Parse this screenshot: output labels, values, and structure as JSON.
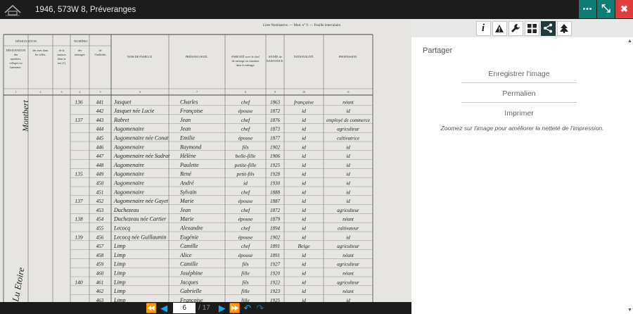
{
  "window": {
    "title": "1946, 573W 8, Préveranges"
  },
  "toolbar": {
    "more_label": "•••",
    "expand_label": "⤡",
    "close_label": "✖"
  },
  "panel": {
    "tools": [
      {
        "name": "info-icon",
        "glyph": "i"
      },
      {
        "name": "warning-icon",
        "glyph": "▲"
      },
      {
        "name": "wrench-icon",
        "glyph": "🔧"
      },
      {
        "name": "grid-icon",
        "glyph": "▦"
      },
      {
        "name": "share-icon",
        "glyph": "⋖"
      },
      {
        "name": "tree-icon",
        "glyph": "♣"
      }
    ],
    "title": "Partager",
    "items": [
      {
        "label": "Enregistrer l'image"
      },
      {
        "label": "Permalien"
      },
      {
        "label": "Imprimer"
      }
    ],
    "hint": "Zoomez sur l'image pour améliorer la netteté de l'impression."
  },
  "document": {
    "header_right": "Liste Nominative. — Mod. n° 9. — Feuille intercalaire.",
    "columns": [
      "DÉSIGNATION des quartiers, villages ou hameaux.",
      "des rues dans les villes.",
      "de la maison dans la rue (1)",
      "des ménages",
      "de l'individu",
      "NOM DE FAMILLE.",
      "PRÉNOM USUEL.",
      "PARENTÉ avec le chef de ménage ou situation dans le ménage.",
      "ANNÉE de NAISSANCE.",
      "NATIONALITÉ.",
      "PROFESSION."
    ],
    "group_designation": "DÉSIGNATION",
    "group_numero": "NUMÉRO",
    "col_numbers": [
      "1",
      "2",
      "3",
      "4",
      "5",
      "6",
      "7",
      "8",
      "9",
      "10",
      "11"
    ],
    "village_left": "Montbert",
    "village_left2": "Lu Etoire",
    "rows": [
      {
        "house": "136",
        "ind": "441",
        "nom": "Jasquet",
        "prenom": "Charles",
        "parente": "chef",
        "annee": "1863",
        "nat": "française",
        "prof": "néant"
      },
      {
        "house": "",
        "ind": "442",
        "nom": "Jasquet née Lucie",
        "prenom": "Françoise",
        "parente": "épouse",
        "annee": "1872",
        "nat": "id",
        "prof": "id"
      },
      {
        "house": "137",
        "ind": "443",
        "nom": "Rabret",
        "prenom": "Jean",
        "parente": "chef",
        "annee": "1876",
        "nat": "id",
        "prof": "employé de commerce"
      },
      {
        "house": "",
        "ind": "444",
        "nom": "Augomenaire",
        "prenom": "Jean",
        "parente": "chef",
        "annee": "1873",
        "nat": "id",
        "prof": "agriculteur"
      },
      {
        "house": "",
        "ind": "445",
        "nom": "Augomenaire née Conat",
        "prenom": "Emilie",
        "parente": "épouse",
        "annee": "1877",
        "nat": "id",
        "prof": "cultivatrice"
      },
      {
        "house": "",
        "ind": "446",
        "nom": "Augomenaire",
        "prenom": "Raymond",
        "parente": "fils",
        "annee": "1902",
        "nat": "id",
        "prof": "id"
      },
      {
        "house": "",
        "ind": "447",
        "nom": "Augomenaire née Sudrat",
        "prenom": "Hélène",
        "parente": "belle-fille",
        "annee": "1906",
        "nat": "id",
        "prof": "id"
      },
      {
        "house": "",
        "ind": "448",
        "nom": "Augomenaire",
        "prenom": "Paulette",
        "parente": "petite-fille",
        "annee": "1925",
        "nat": "id",
        "prof": "id"
      },
      {
        "house": "135",
        "ind": "449",
        "nom": "Augomenaire",
        "prenom": "René",
        "parente": "petit-fils",
        "annee": "1928",
        "nat": "id",
        "prof": "id"
      },
      {
        "house": "",
        "ind": "450",
        "nom": "Augomenaire",
        "prenom": "André",
        "parente": "id",
        "annee": "1930",
        "nat": "id",
        "prof": "id"
      },
      {
        "house": "",
        "ind": "451",
        "nom": "Augomenaire",
        "prenom": "Sylvain",
        "parente": "chef",
        "annee": "1888",
        "nat": "id",
        "prof": "id"
      },
      {
        "house": "137",
        "ind": "452",
        "nom": "Augomenaire née Gayet",
        "prenom": "Marie",
        "parente": "épouse",
        "annee": "1887",
        "nat": "id",
        "prof": "id"
      },
      {
        "house": "",
        "ind": "453",
        "nom": "Duchezeau",
        "prenom": "Jean",
        "parente": "chef",
        "annee": "1872",
        "nat": "id",
        "prof": "agriculteur"
      },
      {
        "house": "138",
        "ind": "454",
        "nom": "Duchezeau née Cartier",
        "prenom": "Marie",
        "parente": "épouse",
        "annee": "1879",
        "nat": "id",
        "prof": "néant"
      },
      {
        "house": "",
        "ind": "455",
        "nom": "Lecocq",
        "prenom": "Alexandre",
        "parente": "chef",
        "annee": "1894",
        "nat": "id",
        "prof": "cultivateur"
      },
      {
        "house": "139",
        "ind": "456",
        "nom": "Lecocq née Guillaumin",
        "prenom": "Eugénie",
        "parente": "épouse",
        "annee": "1902",
        "nat": "id",
        "prof": "id"
      },
      {
        "house": "",
        "ind": "457",
        "nom": "Limp",
        "prenom": "Camille",
        "parente": "chef",
        "annee": "1891",
        "nat": "Belge",
        "prof": "agriculteur"
      },
      {
        "house": "",
        "ind": "458",
        "nom": "Limp",
        "prenom": "Alice",
        "parente": "épouse",
        "annee": "1891",
        "nat": "id",
        "prof": "néant"
      },
      {
        "house": "",
        "ind": "459",
        "nom": "Limp",
        "prenom": "Camille",
        "parente": "fils",
        "annee": "1927",
        "nat": "id",
        "prof": "agriculteur"
      },
      {
        "house": "",
        "ind": "460",
        "nom": "Limp",
        "prenom": "Joséphine",
        "parente": "fille",
        "annee": "1920",
        "nat": "id",
        "prof": "néant"
      },
      {
        "house": "140",
        "ind": "461",
        "nom": "Limp",
        "prenom": "Jacques",
        "parente": "fils",
        "annee": "1922",
        "nat": "id",
        "prof": "agriculteur"
      },
      {
        "house": "",
        "ind": "462",
        "nom": "Limp",
        "prenom": "Gabrielle",
        "parente": "fille",
        "annee": "1923",
        "nat": "id",
        "prof": "néant"
      },
      {
        "house": "",
        "ind": "463",
        "nom": "Limp",
        "prenom": "Françoise",
        "parente": "fille",
        "annee": "1925",
        "nat": "id",
        "prof": "id"
      }
    ]
  },
  "pager": {
    "current": "6",
    "total": "/ 17"
  }
}
